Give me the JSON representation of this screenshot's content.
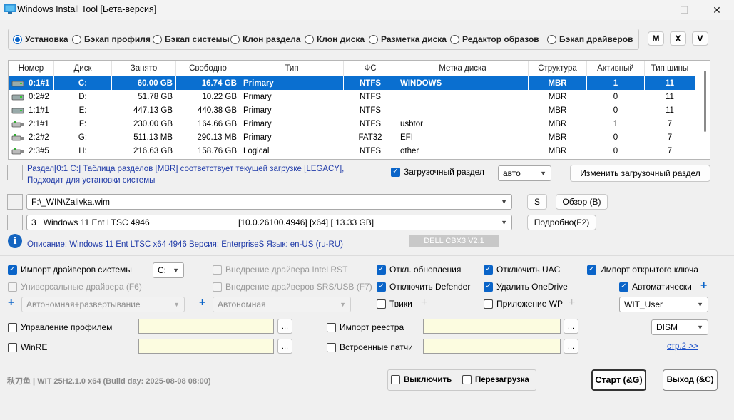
{
  "window": {
    "title": "Windows Install Tool [Бета-версия]",
    "minimize": "—",
    "maximize": "☐",
    "close": "✕"
  },
  "modes": [
    {
      "label": "Установка",
      "selected": true
    },
    {
      "label": "Бэкап профиля",
      "selected": false
    },
    {
      "label": "Бэкап системы",
      "selected": false
    },
    {
      "label": "Клон раздела",
      "selected": false
    },
    {
      "label": "Клон диска",
      "selected": false
    },
    {
      "label": "Разметка диска",
      "selected": false
    },
    {
      "label": "Редактор образов",
      "selected": false
    },
    {
      "label": "Бэкап драйверов",
      "selected": false
    }
  ],
  "mode_buttons": {
    "m": "M",
    "x": "X",
    "v": "V"
  },
  "table": {
    "headers": [
      "Номер",
      "Диск",
      "Занято",
      "Свободно",
      "Тип",
      "ФС",
      "Метка диска",
      "Структура",
      "Активный",
      "Тип шины"
    ],
    "rows": [
      [
        "0:1#1",
        "C:",
        "60.00 GB",
        "16.74 GB",
        "Primary",
        "NTFS",
        "WINDOWS",
        "MBR",
        "1",
        "11"
      ],
      [
        "0:2#2",
        "D:",
        "51.78 GB",
        "10.22 GB",
        "Primary",
        "NTFS",
        "",
        "MBR",
        "0",
        "11"
      ],
      [
        "1:1#1",
        "E:",
        "447.13 GB",
        "440.38 GB",
        "Primary",
        "NTFS",
        "",
        "MBR",
        "0",
        "11"
      ],
      [
        "2:1#1",
        "F:",
        "230.00 GB",
        "164.66 GB",
        "Primary",
        "NTFS",
        "usbtor",
        "MBR",
        "1",
        "7"
      ],
      [
        "2:2#2",
        "G:",
        "511.13 MB",
        "290.13 MB",
        "Primary",
        "FAT32",
        "EFI",
        "MBR",
        "0",
        "7"
      ],
      [
        "2:3#5",
        "H:",
        "216.63 GB",
        "158.76 GB",
        "Logical",
        "NTFS",
        "other",
        "MBR",
        "0",
        "7"
      ]
    ],
    "selected_row": 0
  },
  "partition_info": {
    "line1": "Раздел[0:1 C:] Таблица разделов [MBR] соответствует текущей загрузке [LEGACY],",
    "line2": "Подходит для установки системы"
  },
  "boot": {
    "checkbox_label": "Загрузочный раздел",
    "checked": true,
    "mode_value": "авто",
    "change_button": "Изменить загрузочный раздел"
  },
  "image": {
    "path": "F:\\_WIN\\Zalivka.wim",
    "s_button": "S",
    "browse_button": "Обзор (B)",
    "edition_index": "3",
    "edition_name": "Windows 11 Ent LTSC 4946",
    "edition_build": "[10.0.26100.4946] [x64] [ 13.33 GB]",
    "details_button": "Подробно(F2)",
    "badge": "DELL CBX3 V2.1",
    "description": "Описание: Windows 11 Ent LTSC x64 4946 Версия: EnterpriseS Язык: en-US (ru-RU)"
  },
  "options": {
    "import_drivers": {
      "label": "Импорт драйверов системы",
      "checked": true,
      "drive": "C:"
    },
    "universal_drivers": {
      "label": "Универсальные драйвера (F6)",
      "checked": false,
      "disabled": true
    },
    "deploy_mode": "Автономная+развертывание",
    "intel_rst": {
      "label": "Внедрение драйвера Intel RST",
      "checked": false,
      "disabled": true
    },
    "srs_usb": {
      "label": "Внедрение драйверов SRS/USB (F7)",
      "checked": false,
      "disabled": true
    },
    "autonomous": "Автономная",
    "disable_updates": {
      "label": "Откл. обновления",
      "checked": true
    },
    "disable_defender": {
      "label": "Отключить Defender",
      "checked": true
    },
    "tweaks": {
      "label": "Твики",
      "checked": false
    },
    "disable_uac": {
      "label": "Отключить UAC",
      "checked": true
    },
    "remove_onedrive": {
      "label": "Удалить OneDrive",
      "checked": true
    },
    "app_wp": {
      "label": "Приложение WP",
      "checked": false
    },
    "import_key": {
      "label": "Импорт открытого ключа",
      "checked": true
    },
    "automatic": {
      "label": "Автоматически",
      "checked": true
    },
    "user_value": "WIT_User",
    "profile_mgmt": {
      "label": "Управление профилем",
      "checked": false
    },
    "winre": {
      "label": "WinRE",
      "checked": false
    },
    "registry_import": {
      "label": "Импорт реестра",
      "checked": false
    },
    "builtin_patches": {
      "label": "Встроенные патчи",
      "checked": false
    },
    "dism_value": "DISM",
    "page_link": "стр.2 >>",
    "dots": "..."
  },
  "footer": {
    "version": "秋刀鱼 | WIT 25H2.1.0 x64 (Build day: 2025-08-08 08:00)",
    "shutdown": {
      "label": "Выключить",
      "checked": false
    },
    "reboot": {
      "label": "Перезагрузка",
      "checked": false
    },
    "start_button": "Старт (&G)",
    "exit_button": "Выход (&C)"
  },
  "colors": {
    "accent": "#0a64c8",
    "selection": "#0a6fd0",
    "info_text": "#1f3aa8",
    "field_bg": "#fcfce0"
  }
}
